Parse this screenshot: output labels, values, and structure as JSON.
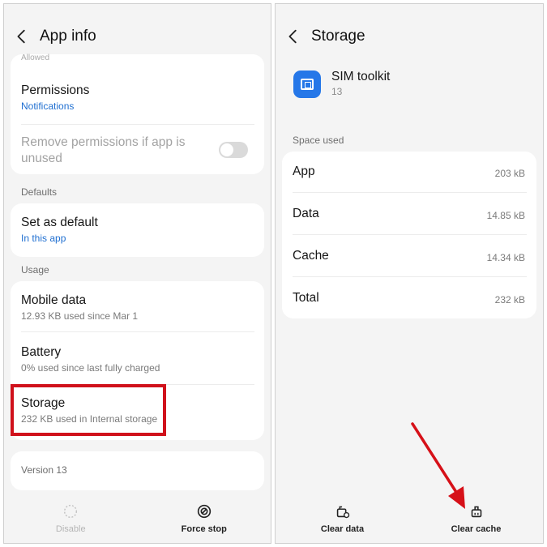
{
  "left": {
    "title": "App info",
    "hidden_top_text": "Allowed",
    "permissions": {
      "title": "Permissions",
      "sub": "Notifications"
    },
    "remove_permissions": {
      "title": "Remove permissions if app is unused"
    },
    "defaults_section": "Defaults",
    "set_default": {
      "title": "Set as default",
      "sub": "In this app"
    },
    "usage_section": "Usage",
    "mobile_data": {
      "title": "Mobile data",
      "sub": "12.93 KB used since Mar 1"
    },
    "battery": {
      "title": "Battery",
      "sub": "0% used since last fully charged"
    },
    "storage": {
      "title": "Storage",
      "sub": "232 KB used in Internal storage"
    },
    "version": "Version 13",
    "bottom": {
      "disable": "Disable",
      "force_stop": "Force stop"
    }
  },
  "right": {
    "title": "Storage",
    "app_name": "SIM toolkit",
    "app_version": "13",
    "space_used_section": "Space used",
    "rows": [
      {
        "label": "App",
        "value": "203 kB"
      },
      {
        "label": "Data",
        "value": "14.85 kB"
      },
      {
        "label": "Cache",
        "value": "14.34 kB"
      },
      {
        "label": "Total",
        "value": "232 kB"
      }
    ],
    "bottom": {
      "clear_data": "Clear data",
      "clear_cache": "Clear cache"
    }
  },
  "colors": {
    "highlight": "#d0111b",
    "link": "#1f6fd1",
    "app_icon": "#2577e8"
  },
  "icons": [
    "back-arrow-icon",
    "disable-icon",
    "force-stop-icon",
    "clear-data-icon",
    "clear-cache-icon",
    "sim-toolkit-app-icon"
  ]
}
